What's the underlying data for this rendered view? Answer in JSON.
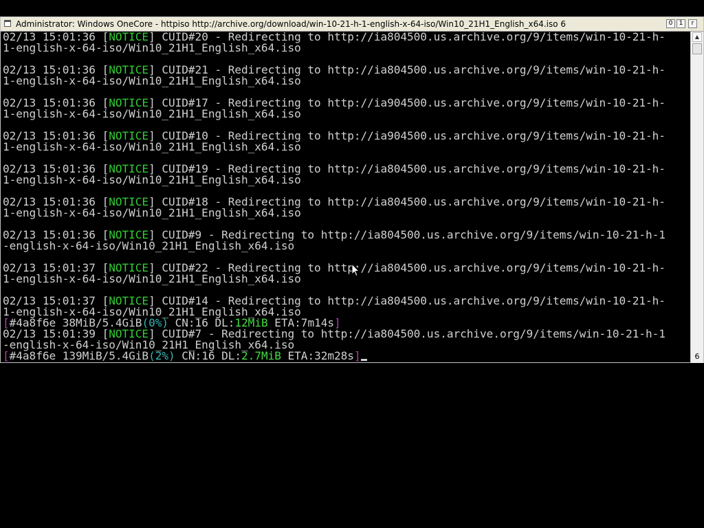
{
  "window": {
    "title": "Administrator:  Windows OneCore - httpiso  http://archive.org/download/win-10-21-h-1-english-x-64-iso/Win10_21H1_English_x64.iso 6",
    "controls": {
      "minimize": "0",
      "maximize": "1",
      "close": "r"
    }
  },
  "console": {
    "lines": [
      [
        {
          "t": "02/13 15:01:36 ["
        },
        {
          "t": "NOTICE",
          "c": "notice"
        },
        {
          "t": "] CUID#20 - Redirecting to http://ia804500.us.archive.org/9/items/win-10-21-h-"
        }
      ],
      [
        {
          "t": "1-english-x-64-iso/Win10_21H1_English_x64.iso"
        }
      ],
      [
        {
          "t": ""
        }
      ],
      [
        {
          "t": "02/13 15:01:36 ["
        },
        {
          "t": "NOTICE",
          "c": "notice"
        },
        {
          "t": "] CUID#21 - Redirecting to http://ia804500.us.archive.org/9/items/win-10-21-h-"
        }
      ],
      [
        {
          "t": "1-english-x-64-iso/Win10_21H1_English_x64.iso"
        }
      ],
      [
        {
          "t": ""
        }
      ],
      [
        {
          "t": "02/13 15:01:36 ["
        },
        {
          "t": "NOTICE",
          "c": "notice"
        },
        {
          "t": "] CUID#17 - Redirecting to http://ia904500.us.archive.org/9/items/win-10-21-h-"
        }
      ],
      [
        {
          "t": "1-english-x-64-iso/Win10_21H1_English_x64.iso"
        }
      ],
      [
        {
          "t": ""
        }
      ],
      [
        {
          "t": "02/13 15:01:36 ["
        },
        {
          "t": "NOTICE",
          "c": "notice"
        },
        {
          "t": "] CUID#10 - Redirecting to http://ia904500.us.archive.org/9/items/win-10-21-h-"
        }
      ],
      [
        {
          "t": "1-english-x-64-iso/Win10_21H1_English_x64.iso"
        }
      ],
      [
        {
          "t": ""
        }
      ],
      [
        {
          "t": "02/13 15:01:36 ["
        },
        {
          "t": "NOTICE",
          "c": "notice"
        },
        {
          "t": "] CUID#19 - Redirecting to http://ia804500.us.archive.org/9/items/win-10-21-h-"
        }
      ],
      [
        {
          "t": "1-english-x-64-iso/Win10_21H1_English_x64.iso"
        }
      ],
      [
        {
          "t": ""
        }
      ],
      [
        {
          "t": "02/13 15:01:36 ["
        },
        {
          "t": "NOTICE",
          "c": "notice"
        },
        {
          "t": "] CUID#18 - Redirecting to http://ia804500.us.archive.org/9/items/win-10-21-h-"
        }
      ],
      [
        {
          "t": "1-english-x-64-iso/Win10_21H1_English_x64.iso"
        }
      ],
      [
        {
          "t": ""
        }
      ],
      [
        {
          "t": "02/13 15:01:36 ["
        },
        {
          "t": "NOTICE",
          "c": "notice"
        },
        {
          "t": "] CUID#9 - Redirecting to http://ia804500.us.archive.org/9/items/win-10-21-h-1"
        }
      ],
      [
        {
          "t": "-english-x-64-iso/Win10_21H1_English_x64.iso"
        }
      ],
      [
        {
          "t": ""
        }
      ],
      [
        {
          "t": "02/13 15:01:37 ["
        },
        {
          "t": "NOTICE",
          "c": "notice"
        },
        {
          "t": "] CUID#22 - Redirecting to http://ia804500.us.archive.org/9/items/win-10-21-h-"
        }
      ],
      [
        {
          "t": "1-english-x-64-iso/Win10_21H1_English_x64.iso"
        }
      ],
      [
        {
          "t": ""
        }
      ],
      [
        {
          "t": "02/13 15:01:37 ["
        },
        {
          "t": "NOTICE",
          "c": "notice"
        },
        {
          "t": "] CUID#14 - Redirecting to http://ia804500.us.archive.org/9/items/win-10-21-h-"
        }
      ],
      [
        {
          "t": "1-english-x-64-iso/Win10_21H1_English_x64.iso"
        }
      ],
      [
        {
          "t": "[",
          "c": "bracket-m"
        },
        {
          "t": "#4a8f6e 38MiB/5.4GiB"
        },
        {
          "t": "(0%)",
          "c": "pct"
        },
        {
          "t": " CN:16 DL:"
        },
        {
          "t": "12MiB",
          "c": "green"
        },
        {
          "t": " ETA:7m14s"
        },
        {
          "t": "]",
          "c": "bracket-m"
        }
      ],
      [
        {
          "t": "02/13 15:01:39 ["
        },
        {
          "t": "NOTICE",
          "c": "notice"
        },
        {
          "t": "] CUID#7 - Redirecting to http://ia804500.us.archive.org/9/items/win-10-21-h-1"
        }
      ],
      [
        {
          "t": "-english-x-64-iso/Win10_21H1_English_x64.iso"
        }
      ],
      [
        {
          "t": "[",
          "c": "bracket-m"
        },
        {
          "t": "#4a8f6e 139MiB/5.4GiB"
        },
        {
          "t": "(2%)",
          "c": "pct"
        },
        {
          "t": " CN:16 DL:"
        },
        {
          "t": "2.7MiB",
          "c": "green"
        },
        {
          "t": " ETA:32m28s"
        },
        {
          "t": "]",
          "c": "bracket-m"
        },
        {
          "t": "",
          "cursor": true
        }
      ]
    ]
  },
  "scrollbar": {
    "up_arrow": "▲",
    "bottom_label": "6"
  },
  "colors": {
    "notice": "#33cc33",
    "bracket": "#b040b0",
    "percent": "#33b5b5",
    "download_rate": "#44dd44",
    "text": "#d0d0d0",
    "background": "#000000"
  }
}
